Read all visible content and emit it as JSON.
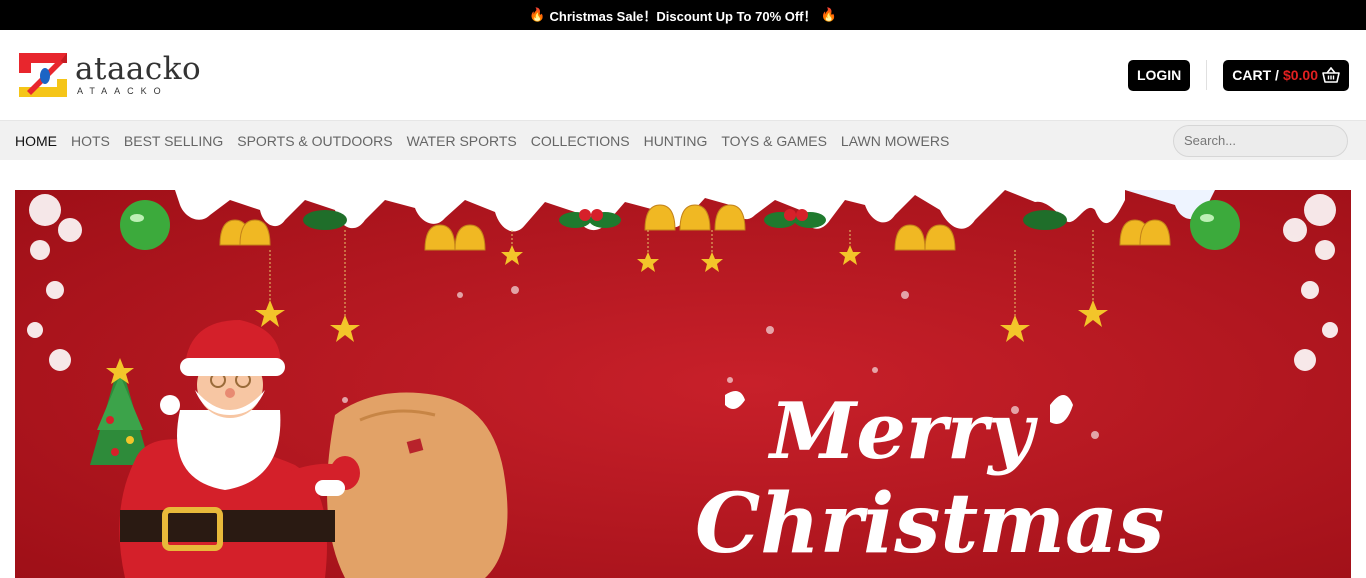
{
  "announcement": {
    "text": "Christmas Sale！Discount Up To 70% Off！",
    "icon": "fire-icon"
  },
  "logo": {
    "name": "ataacko",
    "tagline": "ATAACKO"
  },
  "header": {
    "login_label": "LOGIN",
    "cart_label": "CART /",
    "cart_amount": "$0.00"
  },
  "nav": {
    "items": [
      {
        "label": "HOME",
        "active": true
      },
      {
        "label": "HOTS"
      },
      {
        "label": "BEST SELLING"
      },
      {
        "label": "SPORTS & OUTDOORS"
      },
      {
        "label": "WATER SPORTS"
      },
      {
        "label": "COLLECTIONS"
      },
      {
        "label": "HUNTING"
      },
      {
        "label": "TOYS & GAMES"
      },
      {
        "label": "LAWN MOWERS"
      }
    ],
    "search_placeholder": "Search..."
  },
  "hero": {
    "line1": "Merry",
    "line2": "Christmas",
    "bg_color": "#b5151d"
  }
}
